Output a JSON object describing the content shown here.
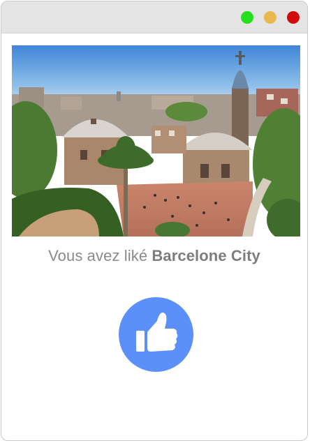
{
  "window": {
    "controls": [
      {
        "name": "maximize",
        "color": "#22e01e"
      },
      {
        "name": "minimize",
        "color": "#e9b94f"
      },
      {
        "name": "close",
        "color": "#d20a0a"
      }
    ]
  },
  "main": {
    "image_icon": "photo-park-guell",
    "caption_prefix": "Vous avez liké",
    "caption_city": "Barcelone City",
    "like_icon": "thumbs-up-icon",
    "like_color": "#5b8ff9"
  }
}
